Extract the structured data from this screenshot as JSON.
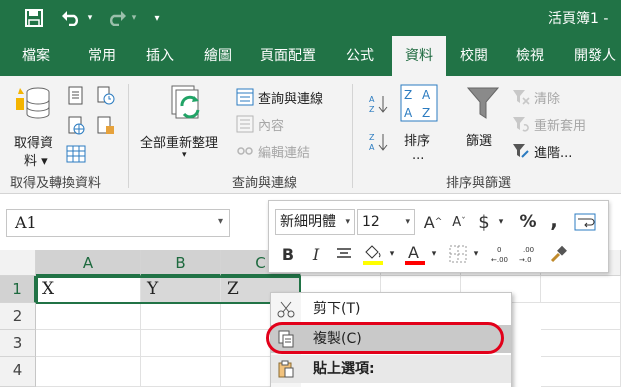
{
  "title_bar": {
    "document_title": "活頁簿1 -",
    "save_icon": "save-icon",
    "undo_icon": "undo-icon",
    "redo_icon": "redo-icon",
    "customize_icon": "customize-qat-icon"
  },
  "tabs": [
    {
      "label": "檔案"
    },
    {
      "label": "常用"
    },
    {
      "label": "插入"
    },
    {
      "label": "繪圖"
    },
    {
      "label": "頁面配置"
    },
    {
      "label": "公式"
    },
    {
      "label": "資料",
      "active": true
    },
    {
      "label": "校閱"
    },
    {
      "label": "檢視"
    },
    {
      "label": "開發人"
    }
  ],
  "ribbon": {
    "get_transform": {
      "group_label": "取得及轉換資料",
      "get_data_label": "取得資",
      "get_data_label2": "料"
    },
    "queries": {
      "group_label": "查詢與連線",
      "refresh_all": "全部重新整理",
      "queries_connections": "查詢與連線",
      "properties": "內容",
      "edit_links": "編輯連結"
    },
    "sort_filter": {
      "group_label": "排序與篩選",
      "sort": "排序",
      "sort_more": "...",
      "filter": "篩選",
      "clear": "清除",
      "reapply": "重新套用",
      "advanced": "進階..."
    }
  },
  "name_box": {
    "value": "A1"
  },
  "mini_toolbar": {
    "font": "新細明體",
    "size": "12",
    "bold": "B",
    "italic": "I",
    "currency": "$",
    "percent": "%",
    "comma": ","
  },
  "grid": {
    "columns": [
      "A",
      "B",
      "C"
    ],
    "rows": [
      "1",
      "2",
      "3",
      "4"
    ],
    "cells": {
      "A1": "X",
      "B1": "Y",
      "C1": "Z"
    }
  },
  "context_menu": {
    "cut": "剪下(T)",
    "copy": "複製(C)",
    "paste_options": "貼上選項:"
  },
  "colors": {
    "excel_green": "#217346",
    "highlight_red": "#e2001a",
    "yellow": "#ffff00",
    "font_red": "#ff0000"
  }
}
